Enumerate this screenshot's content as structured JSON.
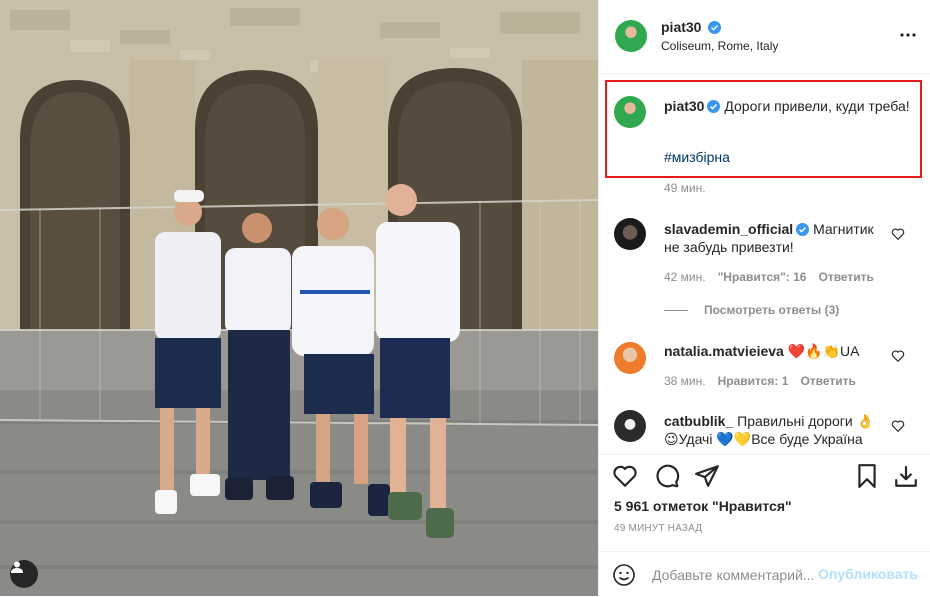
{
  "post": {
    "username": "piat30",
    "location": "Coliseum, Rome, Italy"
  },
  "caption": {
    "username": "piat30",
    "text": "Дороги привели, куди треба!",
    "hashtag": "#мизбірна",
    "time": "49 мин."
  },
  "comments": [
    {
      "username": "slavademin_official",
      "text": "Магнитик не забудь привезти!",
      "time": "42 мин.",
      "likes": "\"Нравится\": 16",
      "reply": "Ответить",
      "view_replies": "Посмотреть ответы (3)"
    },
    {
      "username": "natalia.matvieieva",
      "text": "❤️🔥👏UA",
      "time": "38 мин.",
      "likes": "Нравится: 1",
      "reply": "Ответить"
    },
    {
      "username": "catbublik_",
      "text": "Правильні дороги 👌 😉Удачі 💙💛Все буде Україна",
      "time": "",
      "likes": "",
      "reply": ""
    }
  ],
  "stats": {
    "likes": "5 961 отметок \"Нравится\"",
    "time_ago": "49 МИНУТ НАЗАД"
  },
  "comment_box": {
    "placeholder": "Добавьте комментарий...",
    "publish": "Опубликовать"
  },
  "icons": {
    "more": "more-dots-icon",
    "like": "heart-icon",
    "comment": "comment-bubble-icon",
    "share": "paper-plane-icon",
    "save": "bookmark-icon",
    "download": "download-icon",
    "emoji": "emoji-smile-icon",
    "verified": "verified-badge-icon",
    "tag": "user-tag-icon"
  },
  "colors": {
    "verified": "#3897f0",
    "highlight_border": "#e21b1b",
    "hashtag": "#00376b",
    "publish_disabled": "#b2dffc"
  }
}
